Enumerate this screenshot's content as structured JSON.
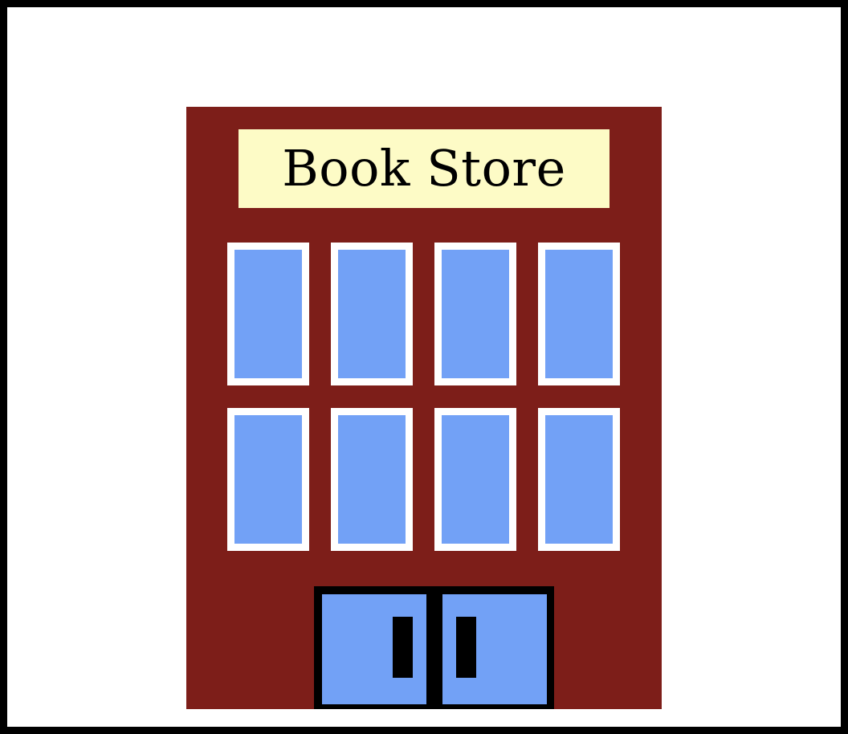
{
  "sign": {
    "text": "Book Store"
  },
  "colors": {
    "frame": "#000000",
    "background": "#ffffff",
    "building": "#7d1e19",
    "sign": "#fdfbc6",
    "glass": "#72a1f6",
    "window_trim": "#ffffff",
    "door_frame": "#000000"
  },
  "building": {
    "window_rows": 2,
    "window_columns": 4,
    "door_count": 2
  }
}
